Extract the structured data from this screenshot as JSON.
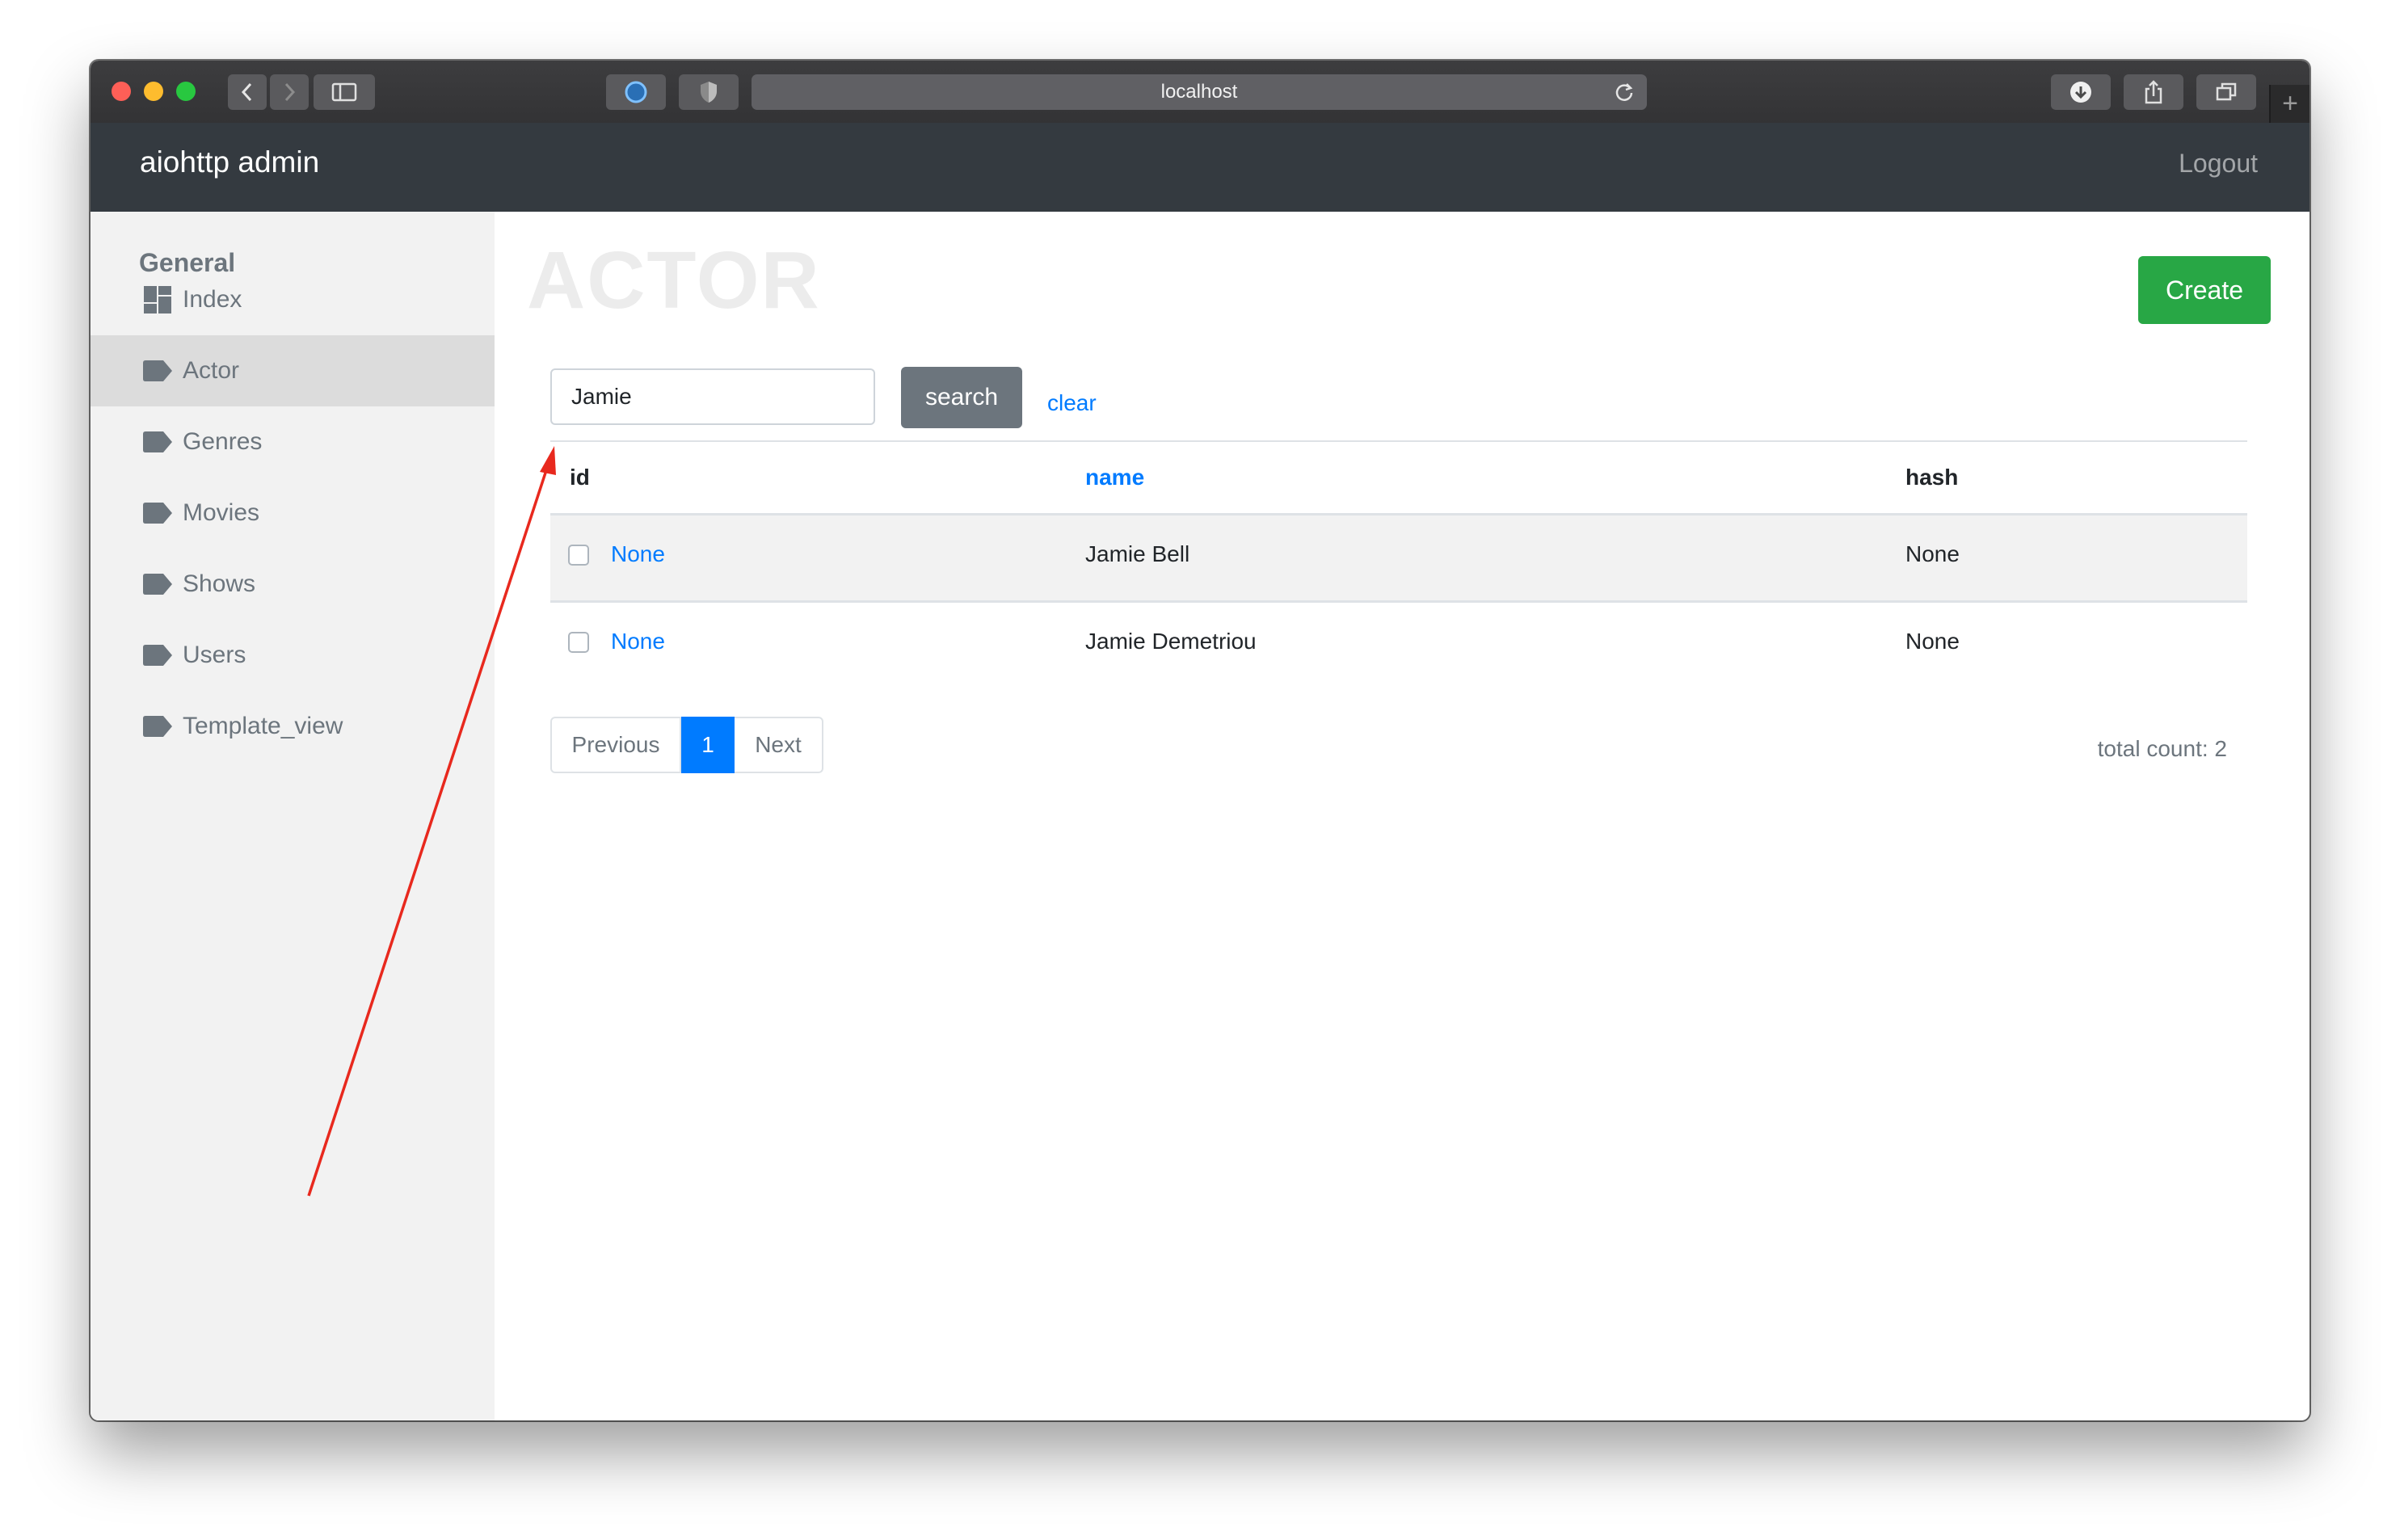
{
  "browser": {
    "url": "localhost",
    "new_tab_symbol": "+"
  },
  "app": {
    "brand": "aiohttp admin",
    "logout_label": "Logout"
  },
  "sidebar": {
    "heading": "General",
    "items": [
      {
        "label": "Index",
        "icon": "dashboard-icon"
      },
      {
        "label": "Actor",
        "icon": "tag-icon"
      },
      {
        "label": "Genres",
        "icon": "tag-icon"
      },
      {
        "label": "Movies",
        "icon": "tag-icon"
      },
      {
        "label": "Shows",
        "icon": "tag-icon"
      },
      {
        "label": "Users",
        "icon": "tag-icon"
      },
      {
        "label": "Template_view",
        "icon": "tag-icon"
      }
    ],
    "active_item": "Actor"
  },
  "main": {
    "title": "ACTOR",
    "create_label": "Create",
    "search": {
      "value": "Jamie",
      "button_label": "search",
      "clear_label": "clear"
    },
    "table": {
      "columns": [
        "id",
        "name",
        "hash"
      ],
      "rows": [
        {
          "id": "None",
          "name": "Jamie Bell",
          "hash": "None"
        },
        {
          "id": "None",
          "name": "Jamie Demetriou",
          "hash": "None"
        }
      ]
    },
    "pagination": {
      "previous_label": "Previous",
      "current_page": "1",
      "next_label": "Next"
    },
    "total_count": "total count: 2"
  },
  "colors": {
    "navbar": "#343a40",
    "primary": "#007bff",
    "success": "#28a745",
    "secondary": "#6c757d",
    "annotation_arrow": "#e8291e"
  }
}
